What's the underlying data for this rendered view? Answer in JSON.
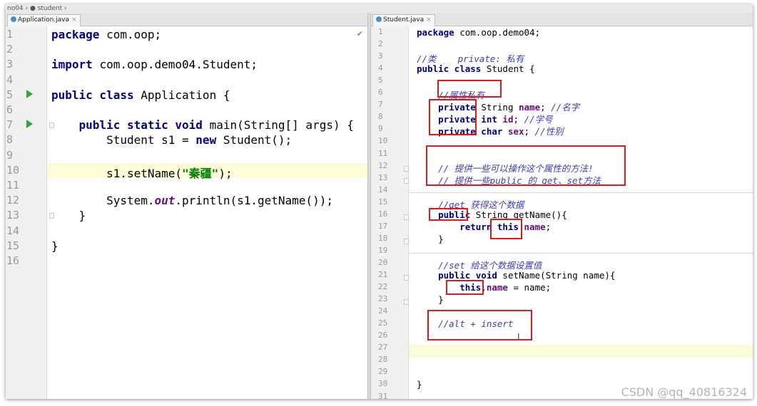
{
  "breadcrumb": {
    "text": "no04 › ● student ›"
  },
  "left_tab": {
    "label": "Application.java"
  },
  "right_tab": {
    "label": "Student.java"
  },
  "left_editor": {
    "line_numbers": [
      "1",
      "2",
      "3",
      "4",
      "5",
      "6",
      "7",
      "8",
      "9",
      "10",
      "11",
      "12",
      "13",
      "14",
      "15",
      "16"
    ],
    "lines": [
      [
        {
          "t": "package ",
          "c": "kw"
        },
        {
          "t": "com.oop;"
        }
      ],
      [],
      [
        {
          "t": "import ",
          "c": "kw"
        },
        {
          "t": "com.oop.demo04.Student;"
        }
      ],
      [],
      [
        {
          "t": "public class ",
          "c": "kw"
        },
        {
          "t": "Application {"
        }
      ],
      [],
      [
        {
          "t": "    public static void ",
          "c": "kw"
        },
        {
          "t": "main(String[] args) {"
        }
      ],
      [
        {
          "t": "        Student s1 = "
        },
        {
          "t": "new ",
          "c": "kw"
        },
        {
          "t": "Student();"
        }
      ],
      [],
      [
        {
          "t": "        s1.setName("
        },
        {
          "t": "\"秦疆\"",
          "c": "str"
        },
        {
          "t": ");"
        }
      ],
      [],
      [
        {
          "t": "        System."
        },
        {
          "t": "out",
          "c": "st"
        },
        {
          "t": ".println(s1.getName());"
        }
      ],
      [
        {
          "t": "    }"
        }
      ],
      [],
      [
        {
          "t": "}"
        }
      ],
      []
    ]
  },
  "right_editor": {
    "line_numbers": [
      "1",
      "2",
      "3",
      "4",
      "5",
      "6",
      "7",
      "8",
      "9",
      "10",
      "11",
      "12",
      "13",
      "14",
      "15",
      "16",
      "17",
      "18",
      "19",
      "20",
      "21",
      "22",
      "23",
      "24",
      "25",
      "26",
      "27",
      "28",
      "29",
      "30",
      "31"
    ],
    "lines": [
      [
        {
          "t": "package ",
          "c": "kw"
        },
        {
          "t": "com.oop.demo04;"
        }
      ],
      [],
      [
        {
          "t": "//类    private: 私有",
          "c": "cm"
        }
      ],
      [
        {
          "t": "public class ",
          "c": "kw"
        },
        {
          "t": "Student {"
        }
      ],
      [],
      [
        {
          "t": "    //属性私有",
          "c": "cm"
        }
      ],
      [
        {
          "t": "    private ",
          "c": "kw"
        },
        {
          "t": "String "
        },
        {
          "t": "name",
          "c": "fld"
        },
        {
          "t": "; "
        },
        {
          "t": "//名字",
          "c": "cm"
        }
      ],
      [
        {
          "t": "    private int ",
          "c": "kw"
        },
        {
          "t": "id",
          "c": "fld"
        },
        {
          "t": "; "
        },
        {
          "t": "//学号",
          "c": "cm"
        }
      ],
      [
        {
          "t": "    private char ",
          "c": "kw"
        },
        {
          "t": "sex",
          "c": "fld"
        },
        {
          "t": "; "
        },
        {
          "t": "//性别",
          "c": "cm"
        }
      ],
      [],
      [],
      [
        {
          "t": "    // 提供一些可以操作这个属性的方法!",
          "c": "cm"
        }
      ],
      [
        {
          "t": "    // 提供一些public 的 get、set方法",
          "c": "cm"
        }
      ],
      [],
      [
        {
          "t": "    //get 获得这个数据",
          "c": "cm"
        }
      ],
      [
        {
          "t": "    public ",
          "c": "kw"
        },
        {
          "t": "String getName(){"
        }
      ],
      [
        {
          "t": "        return this",
          "c": "kw"
        },
        {
          "t": "."
        },
        {
          "t": "name",
          "c": "fld"
        },
        {
          "t": ";"
        }
      ],
      [
        {
          "t": "    }"
        }
      ],
      [],
      [
        {
          "t": "    //set 给这个数据设置值",
          "c": "cm"
        }
      ],
      [
        {
          "t": "    public void ",
          "c": "kw"
        },
        {
          "t": "setName(String name){"
        }
      ],
      [
        {
          "t": "        this",
          "c": "kw"
        },
        {
          "t": "."
        },
        {
          "t": "name",
          "c": "fld"
        },
        {
          "t": " = name;"
        }
      ],
      [
        {
          "t": "    }"
        }
      ],
      [],
      [
        {
          "t": "    //alt + insert",
          "c": "cm"
        }
      ],
      [],
      [],
      [],
      [],
      [
        {
          "t": "}"
        }
      ],
      []
    ]
  },
  "watermark": "CSDN @qq_40816324",
  "colors": {
    "keyword": "#000080",
    "string": "#008000",
    "field": "#660e7a",
    "comment": "#3d3db8",
    "annotation_box": "#e01818",
    "current_line": "#fcfcd8"
  }
}
